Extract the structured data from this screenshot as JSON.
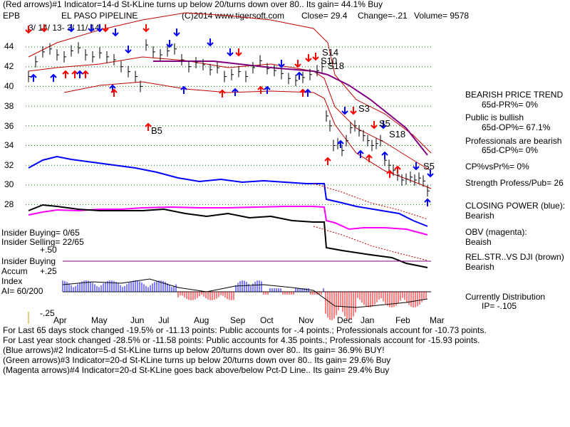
{
  "header": {
    "line1": "(Red arrows)#1 Indicator=14-d St-KLine turns up below 20/turns down over 80.. Its gain= 44.1% Buy",
    "ticker": "EPB",
    "company": "EL PASO PIPELINE",
    "copyright": "(C)2014 www.tigersoft.com",
    "close": "Close=  29.4",
    "change": "Change=-.21",
    "volume": "Volume=  9578",
    "date_range": "3/ 14/ 13- 3/ 11/ 14"
  },
  "chart_data": {
    "type": "line",
    "title": "EL PASO PIPELINE",
    "y_ticks": [
      "44",
      "42",
      "40",
      "38",
      "36",
      "34",
      "32",
      "30",
      "28"
    ],
    "ylim": [
      27,
      46
    ],
    "x_months": [
      "Apr",
      "May",
      "Jun",
      "Jul",
      "Aug",
      "Sep",
      "Oct",
      "Nov",
      "Dec",
      "Jan",
      "Feb",
      "Mar"
    ],
    "grid": true,
    "signals": [
      "S14",
      "S10",
      "S18",
      "S3",
      "S5",
      "S18",
      "S5",
      "B5"
    ]
  },
  "right_panel": {
    "trend_title": "BEARISH PRICE TREND",
    "pr": "65d-PR%= 0%",
    "public_title": "Public is bullish",
    "op": "65d-OP%= 67.1%",
    "prof_title": "Professionals are bearish",
    "cp": "65d-CP%= 0%",
    "cpvspr": "CP%vsPr%=  0%",
    "strength": "Strength Profess/Pub= 26",
    "closing_power": "CLOSING POWER (blue):",
    "closing_power_val": "Bearish",
    "obv": "OBV (magenta):",
    "obv_val": "Beaish",
    "relstr": "REL.STR..VS DJI (brown)",
    "relstr_val": "Bearish",
    "distribution": "Currently Distribution",
    "ip": "IP= -.105"
  },
  "left_panel": {
    "insider_buying": "Insider Buying= 0/65",
    "insider_selling": "Insider Selling= 22/65",
    "insider_buying_label": "Insider Buying",
    "accum": "Accum",
    "index": "Index",
    "ai": "AI= 60/200",
    "p50": "+.50",
    "p25": "+.25",
    "m25": "-.25"
  },
  "footer": {
    "line1": "For Last 65 days stock changed -19.5% or -11.13 points:  Public accounts for -.4 points.;  Professionals account for -10.73 points.",
    "line2": "For Last year stock changed -28.5% or -11.58 points:  Public accounts for  4.35 points.;  Professionals account for -15.93 points.",
    "line3": "(Blue arrows)#2 Indicator=5-d St-KLine turns up below 20/turns down over 80.. Its gain= 36.9% BUY!",
    "line4": "(Green arrows)#3 Indicator=20-d St-KLine turns up below 20/turns down over 80.. Its gain= 29.6% Buy",
    "line5": "(Magenta arrows)#4 Indicator=20-d St-KLine goes back above/below Pct-D Line.. Its gain= 29.4% Buy"
  },
  "colors": {
    "red": "#ff0000",
    "blue": "#0000ff",
    "magenta": "#ff00ff",
    "purple": "#800080",
    "dark_red": "#c00000",
    "grid": "#008000"
  }
}
